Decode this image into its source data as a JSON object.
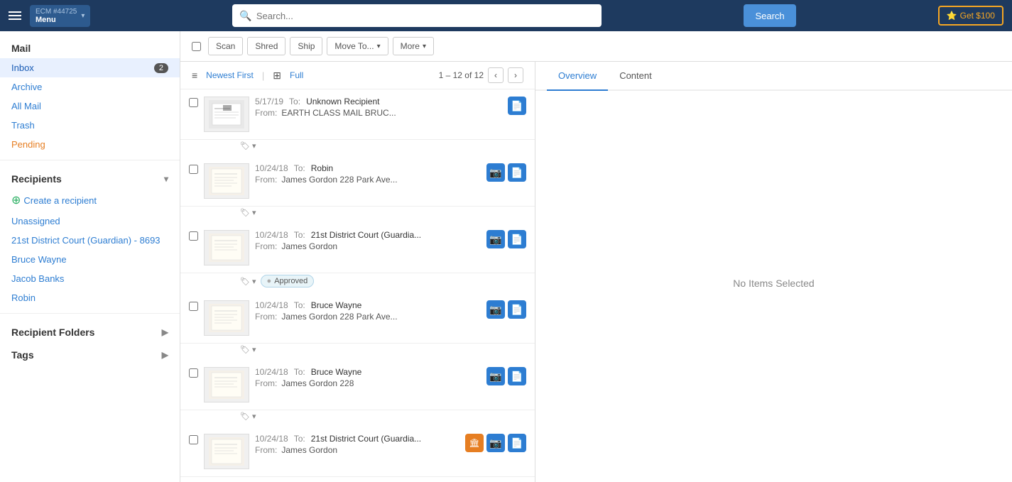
{
  "header": {
    "ecm_number": "ECM #44725",
    "menu_label": "Menu",
    "search_placeholder": "Search...",
    "search_button": "Search",
    "get_money_button": "Get $100"
  },
  "sidebar": {
    "mail_section": "Mail",
    "items": [
      {
        "id": "inbox",
        "label": "Inbox",
        "badge": "2",
        "active": true
      },
      {
        "id": "archive",
        "label": "Archive",
        "badge": null
      },
      {
        "id": "all-mail",
        "label": "All Mail",
        "badge": null
      },
      {
        "id": "trash",
        "label": "Trash",
        "badge": null
      },
      {
        "id": "pending",
        "label": "Pending",
        "badge": null
      }
    ],
    "recipients_section": "Recipients",
    "create_recipient": "Create a recipient",
    "recipients": [
      {
        "id": "unassigned",
        "label": "Unassigned"
      },
      {
        "id": "21st-district",
        "label": "21st District Court (Guardian) - 8693"
      },
      {
        "id": "bruce-wayne",
        "label": "Bruce Wayne"
      },
      {
        "id": "jacob-banks",
        "label": "Jacob Banks"
      },
      {
        "id": "robin",
        "label": "Robin"
      }
    ],
    "recipient_folders": "Recipient Folders",
    "tags": "Tags"
  },
  "toolbar": {
    "scan": "Scan",
    "shred": "Shred",
    "ship": "Ship",
    "move_to": "Move To...",
    "more": "More"
  },
  "list": {
    "sort_newest": "Newest First",
    "sort_full": "Full",
    "pagination_text": "1 – 12 of 12",
    "items": [
      {
        "date": "5/17/19",
        "to_label": "To:",
        "to": "Unknown Recipient",
        "from_label": "From:",
        "from": "EARTH CLASS MAIL BRUC...",
        "has_camera": false,
        "has_document": true,
        "has_archive": false,
        "has_approved": false
      },
      {
        "date": "10/24/18",
        "to_label": "To:",
        "to": "Robin",
        "from_label": "From:",
        "from": "James Gordon 228 Park Ave...",
        "has_camera": true,
        "has_document": true,
        "has_archive": false,
        "has_approved": false
      },
      {
        "date": "10/24/18",
        "to_label": "To:",
        "to": "21st District Court (Guardia...",
        "from_label": "From:",
        "from": "James Gordon",
        "has_camera": true,
        "has_document": true,
        "has_archive": false,
        "has_approved": true
      },
      {
        "date": "10/24/18",
        "to_label": "To:",
        "to": "Bruce Wayne",
        "from_label": "From:",
        "from": "James Gordon 228 Park Ave...",
        "has_camera": true,
        "has_document": true,
        "has_archive": false,
        "has_approved": false
      },
      {
        "date": "10/24/18",
        "to_label": "To:",
        "to": "Bruce Wayne",
        "from_label": "From:",
        "from": "James Gordon 228",
        "has_camera": true,
        "has_document": true,
        "has_archive": false,
        "has_approved": false
      },
      {
        "date": "10/24/18",
        "to_label": "To:",
        "to": "21st District Court (Guardia...",
        "from_label": "From:",
        "from": "James Gordon",
        "has_camera": true,
        "has_document": true,
        "has_archive": true,
        "has_approved": false
      }
    ]
  },
  "detail": {
    "tab_overview": "Overview",
    "tab_content": "Content",
    "no_items": "No Items Selected"
  }
}
